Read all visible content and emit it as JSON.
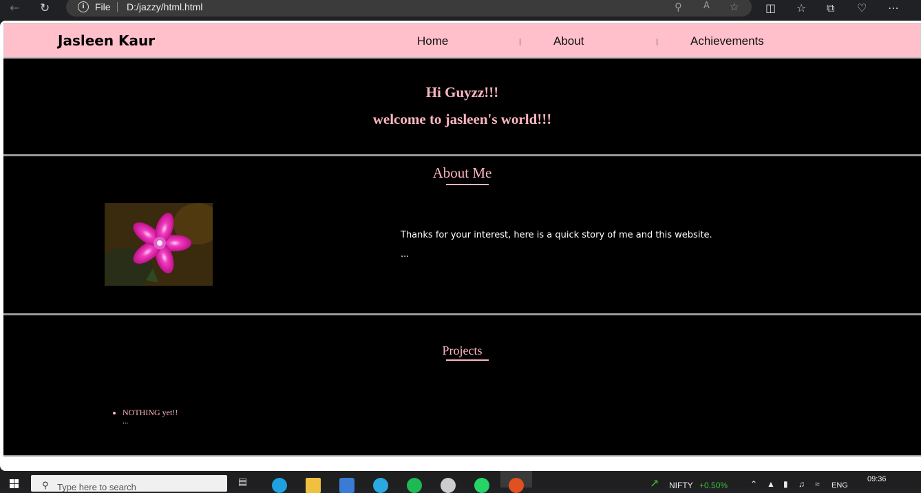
{
  "browser": {
    "file_label": "File",
    "url": "D:/jazzy/html.html"
  },
  "nav": {
    "brand": "Jasleen Kaur",
    "links": [
      "Home",
      "About",
      "Achievements"
    ]
  },
  "hero": {
    "line1": "Hi Guyzz!!!",
    "line2": "welcome to jasleen's world!!!"
  },
  "about": {
    "title": "About Me",
    "text": "Thanks for your interest, here is a quick story of me and this website.",
    "ellipsis": "..."
  },
  "projects": {
    "title": "Projects",
    "items": [
      "NOTHING yet!!"
    ],
    "ellipsis": "..."
  },
  "taskbar": {
    "search_placeholder": "Type here to search",
    "stock_name": "NIFTY",
    "stock_change": "+0.50%",
    "language": "ENG",
    "time": "09:36"
  },
  "colors": {
    "nav_bg": "#ffc0cb",
    "accent": "#ffb6c1",
    "section_bg": "#000000",
    "stock_up": "#3fbf3f"
  }
}
